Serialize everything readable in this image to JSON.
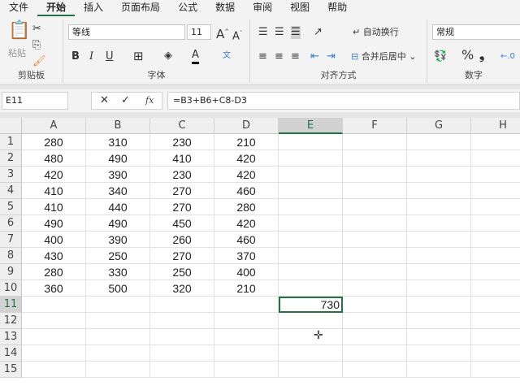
{
  "menu": [
    "文件",
    "开始",
    "插入",
    "页面布局",
    "公式",
    "数据",
    "审阅",
    "视图",
    "帮助"
  ],
  "ribbon": {
    "clipboard": {
      "paste": "粘贴",
      "label": "剪贴板"
    },
    "font": {
      "name": "等线",
      "size": "11",
      "bold": "B",
      "italic": "I",
      "underline": "U",
      "label": "字体"
    },
    "alignment": {
      "wrap": "自动换行",
      "merge": "合并后居中",
      "label": "对齐方式"
    },
    "number": {
      "format": "常规",
      "percent": "%",
      "comma": "❟",
      "label": "数字"
    }
  },
  "formula_bar": {
    "name_box": "E11",
    "fx": "fx",
    "formula": "=B3+B6+C8-D3"
  },
  "columns": [
    "A",
    "B",
    "C",
    "D",
    "E",
    "F",
    "G",
    "H"
  ],
  "rows": [
    "1",
    "2",
    "3",
    "4",
    "5",
    "6",
    "7",
    "8",
    "9",
    "10",
    "11",
    "12",
    "13",
    "14",
    "15"
  ],
  "data": [
    [
      "280",
      "310",
      "230",
      "210"
    ],
    [
      "480",
      "490",
      "410",
      "420"
    ],
    [
      "420",
      "390",
      "230",
      "420"
    ],
    [
      "410",
      "340",
      "270",
      "460"
    ],
    [
      "410",
      "440",
      "270",
      "280"
    ],
    [
      "490",
      "490",
      "450",
      "420"
    ],
    [
      "400",
      "390",
      "260",
      "460"
    ],
    [
      "430",
      "250",
      "270",
      "370"
    ],
    [
      "280",
      "330",
      "250",
      "400"
    ],
    [
      "360",
      "500",
      "320",
      "210"
    ]
  ],
  "result": {
    "cell": "E11",
    "value": "730"
  }
}
